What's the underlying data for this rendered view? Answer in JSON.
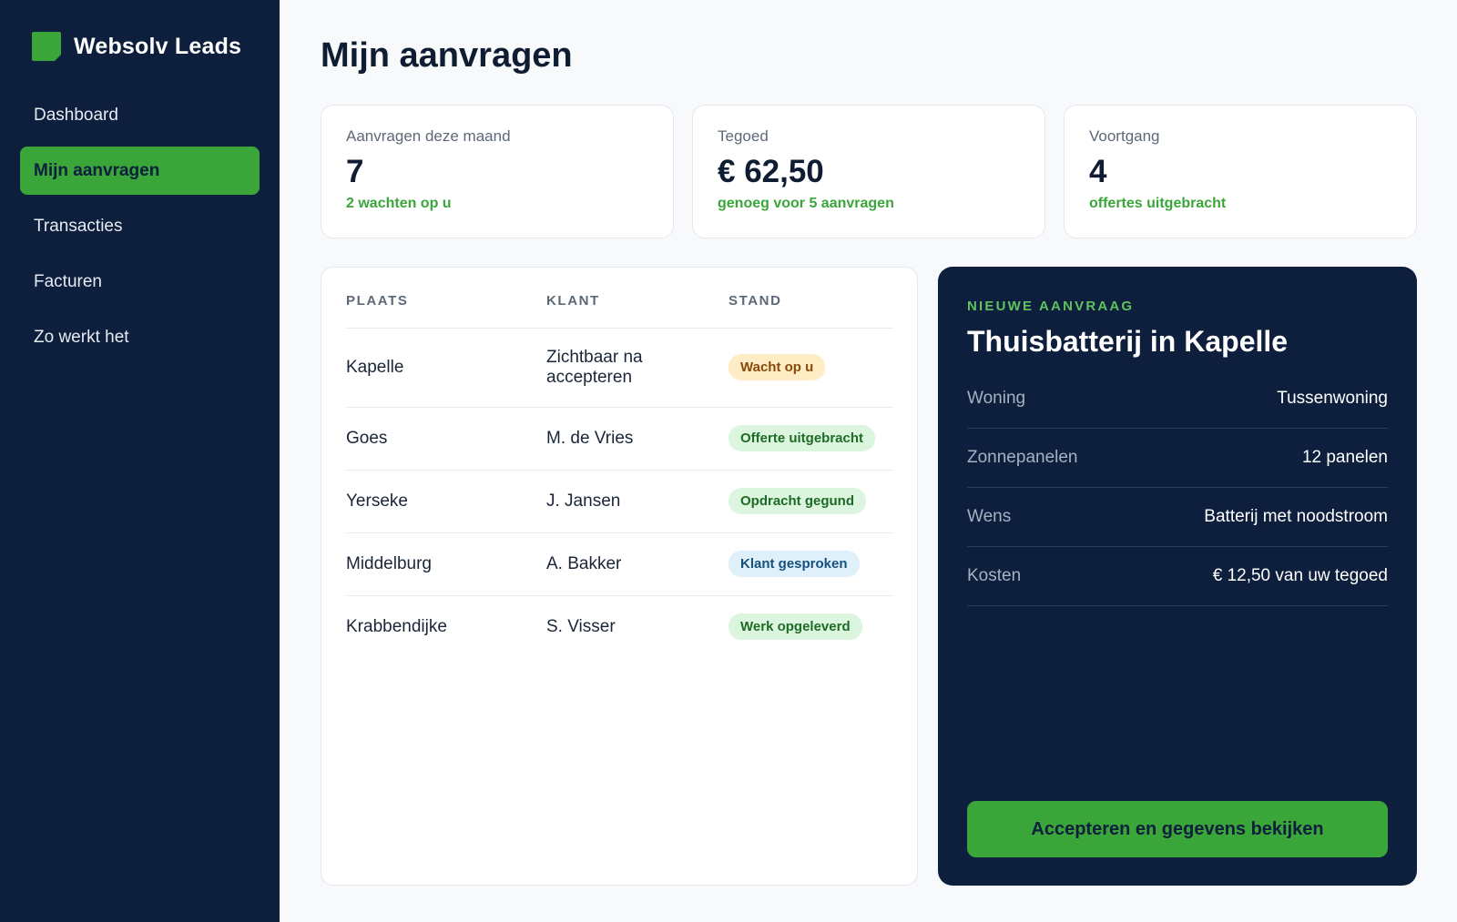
{
  "brand": {
    "name": "Websolv Leads"
  },
  "nav": [
    {
      "label": "Dashboard"
    },
    {
      "label": "Mijn aanvragen"
    },
    {
      "label": "Transacties"
    },
    {
      "label": "Facturen"
    },
    {
      "label": "Zo werkt het"
    }
  ],
  "page": {
    "title": "Mijn aanvragen"
  },
  "stats": [
    {
      "label": "Aanvragen deze maand",
      "value": "7",
      "sub": "2 wachten op u"
    },
    {
      "label": "Tegoed",
      "value": "€ 62,50",
      "sub": "genoeg voor 5 aanvragen"
    },
    {
      "label": "Voortgang",
      "value": "4",
      "sub": "offertes uitgebracht"
    }
  ],
  "table": {
    "headers": [
      "PLAATS",
      "KLANT",
      "STAND"
    ],
    "rows": [
      {
        "place": "Kapelle",
        "client": "Zichtbaar na accepteren",
        "status": "Wacht op u"
      },
      {
        "place": "Goes",
        "client": "M. de Vries",
        "status": "Offerte uitgebracht"
      },
      {
        "place": "Yerseke",
        "client": "J. Jansen",
        "status": "Opdracht gegund"
      },
      {
        "place": "Middelburg",
        "client": "A. Bakker",
        "status": "Klant gesproken"
      },
      {
        "place": "Krabbendijke",
        "client": "S. Visser",
        "status": "Werk opgeleverd"
      }
    ]
  },
  "detail": {
    "kicker": "NIEUWE AANVRAAG",
    "title": "Thuisbatterij in Kapelle",
    "rows": [
      {
        "key": "Woning",
        "value": "Tussenwoning"
      },
      {
        "key": "Zonnepanelen",
        "value": "12 panelen"
      },
      {
        "key": "Wens",
        "value": "Batterij met noodstroom"
      },
      {
        "key": "Kosten",
        "value": "€ 12,50 van uw tegoed"
      }
    ],
    "cta": "Accepteren en gegevens bekijken"
  },
  "colors": {
    "navy": "#0d1f3c",
    "green": "#3aa63a",
    "background": "#f7f9fb"
  }
}
